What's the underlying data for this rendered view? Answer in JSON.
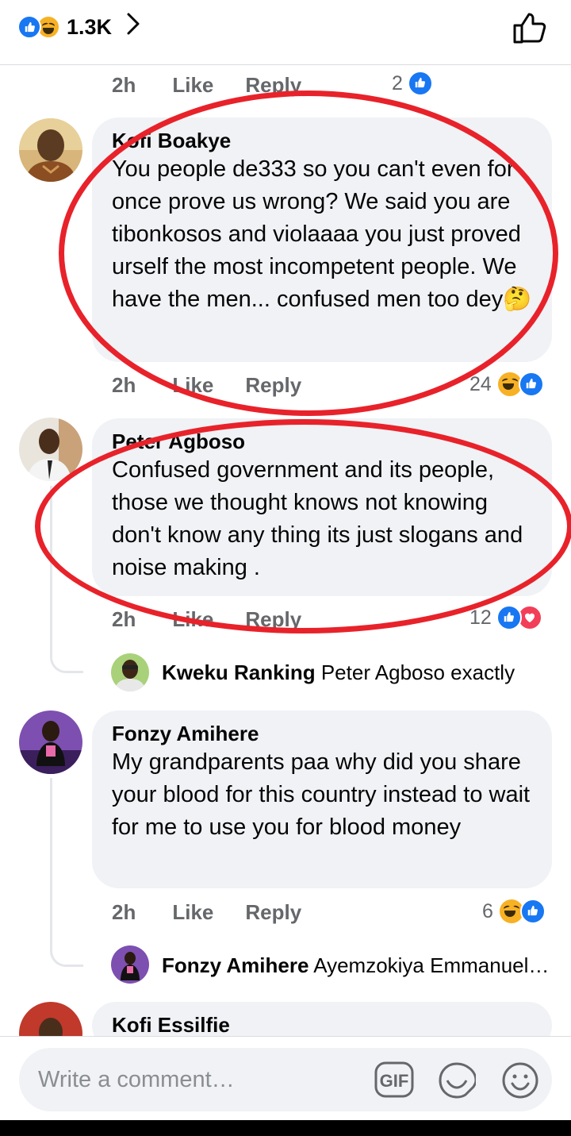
{
  "header": {
    "reaction_count": "1.3K",
    "reaction_icons": [
      "like-icon",
      "haha-icon"
    ],
    "chevron": "chevron-right-icon",
    "like_page_icon": "thumbs-up-outline-icon"
  },
  "comments": [
    {
      "time": "2h",
      "like_label": "Like",
      "reply_label": "Reply",
      "reaction_count": "2",
      "reactions": [
        "like-icon"
      ]
    },
    {
      "name": "Kofi Boakye",
      "text": "You people de333 so you can't even for once prove us wrong? We said you are tibonkosos and violaaaa you just proved urself the most incompetent people. We have the men... confused men too dey🤔",
      "time": "2h",
      "like_label": "Like",
      "reply_label": "Reply",
      "reaction_count": "24",
      "reactions": [
        "haha-icon",
        "like-icon"
      ]
    },
    {
      "name": "Peter Agboso",
      "text": "Confused government and its people, those we thought knows not knowing don't know  any thing its just slogans and noise making .",
      "time": "2h",
      "like_label": "Like",
      "reply_label": "Reply",
      "reaction_count": "12",
      "reactions": [
        "like-icon",
        "love-icon"
      ],
      "reply": {
        "name": "Kweku Ranking",
        "text": "Peter Agboso exactly"
      }
    },
    {
      "name": "Fonzy Amihere",
      "text": "My grandparents paa why did you share your blood for this country instead to wait for me to use you for blood money",
      "time": "2h",
      "like_label": "Like",
      "reply_label": "Reply",
      "reaction_count": "6",
      "reactions": [
        "haha-icon",
        "like-icon"
      ],
      "reply": {
        "name": "Fonzy Amihere",
        "text": "Ayemzokiya Emmanuel…"
      }
    },
    {
      "name": "Kofi Essilfie"
    }
  ],
  "composer": {
    "placeholder": "Write a comment…",
    "icons": [
      "gif-icon",
      "sticker-icon",
      "emoji-icon"
    ]
  },
  "colors": {
    "facebook_blue": "#1877f2",
    "bubble_bg": "#f0f2f5",
    "annotation_red": "#e8222a",
    "meta_gray": "#65676b"
  }
}
